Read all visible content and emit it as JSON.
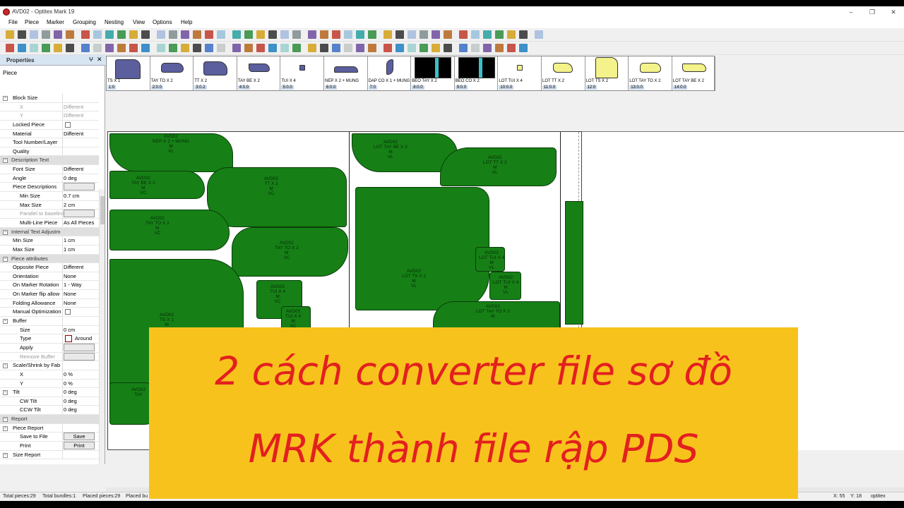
{
  "window": {
    "title": "AVD02 - Optitex Mark 19",
    "controls": [
      "–",
      "❐",
      "✕"
    ]
  },
  "menu": [
    "File",
    "Piece",
    "Marker",
    "Grouping",
    "Nesting",
    "View",
    "Options",
    "Help"
  ],
  "properties": {
    "header": "Properties",
    "pin": "ⵖ",
    "close": "✕",
    "subject": "Piece",
    "rows": [
      {
        "label": "Block Size",
        "value": "",
        "kind": "cat-plain"
      },
      {
        "label": "X",
        "value": "Different",
        "kind": "dim"
      },
      {
        "label": "Y",
        "value": "Different",
        "kind": "dim"
      },
      {
        "label": "Locked Piece",
        "value": "",
        "kind": "checkbox"
      },
      {
        "label": "Material",
        "value": "Different",
        "kind": "plain"
      },
      {
        "label": "Tool Number/Layer",
        "value": "",
        "kind": "plain"
      },
      {
        "label": "Quality",
        "value": "",
        "kind": "plain"
      },
      {
        "label": "Description Text",
        "value": "",
        "kind": "cat"
      },
      {
        "label": "Font Size",
        "value": "Different",
        "kind": "plain"
      },
      {
        "label": "Angle",
        "value": "0 deg",
        "kind": "plain"
      },
      {
        "label": "Piece Descriptions",
        "value": "",
        "kind": "button-empty"
      },
      {
        "label": "Min Size",
        "value": "0.7 cm",
        "kind": "sub"
      },
      {
        "label": "Max Size",
        "value": "2 cm",
        "kind": "sub"
      },
      {
        "label": "Parallel to baseline",
        "value": "",
        "kind": "sub-dim-btn"
      },
      {
        "label": "Multi-Line Piece",
        "value": "As All Pieces",
        "kind": "sub"
      },
      {
        "label": "Internal Text Adjustment",
        "value": "",
        "kind": "cat"
      },
      {
        "label": "Min Size",
        "value": "1 cm",
        "kind": "plain"
      },
      {
        "label": "Max Size",
        "value": "1 cm",
        "kind": "plain"
      },
      {
        "label": "Piece attributes",
        "value": "",
        "kind": "cat"
      },
      {
        "label": "Opposite Piece",
        "value": "Different",
        "kind": "plain"
      },
      {
        "label": "Orientation",
        "value": "None",
        "kind": "plain"
      },
      {
        "label": "On Marker Rotation",
        "value": "1 - Way",
        "kind": "plain"
      },
      {
        "label": "On Marker flip allow",
        "value": "None",
        "kind": "plain"
      },
      {
        "label": "Folding Allowance",
        "value": "None",
        "kind": "plain"
      },
      {
        "label": "Manual Optimization",
        "value": "",
        "kind": "checkbox"
      },
      {
        "label": "Buffer",
        "value": "",
        "kind": "cat-plain"
      },
      {
        "label": "Size",
        "value": "0 cm",
        "kind": "sub"
      },
      {
        "label": "Type",
        "value": "Around",
        "kind": "sub-swatch"
      },
      {
        "label": "Apply",
        "value": "",
        "kind": "sub-btn"
      },
      {
        "label": "Remove Buffer",
        "value": "",
        "kind": "sub-dim-btn"
      },
      {
        "label": "Scale/Shrink by Fab",
        "value": "",
        "kind": "cat-plain"
      },
      {
        "label": "X",
        "value": "0 %",
        "kind": "sub"
      },
      {
        "label": "Y",
        "value": "0 %",
        "kind": "sub"
      },
      {
        "label": "Tilt",
        "value": "0 deg",
        "kind": "cat-plain-val"
      },
      {
        "label": "CW Tilt",
        "value": "0 deg",
        "kind": "sub"
      },
      {
        "label": "CCW Tilt",
        "value": "0 deg",
        "kind": "sub"
      },
      {
        "label": "Report",
        "value": "",
        "kind": "cat"
      },
      {
        "label": "Piece Report",
        "value": "",
        "kind": "cat-plain"
      },
      {
        "label": "Save to File",
        "value": "Save",
        "kind": "sub-btn"
      },
      {
        "label": "Print",
        "value": "Print",
        "kind": "sub-btn"
      },
      {
        "label": "Size Report",
        "value": "",
        "kind": "cat-plain"
      }
    ]
  },
  "palette": [
    {
      "name": "TS X 1",
      "num": "1:0",
      "fill": "#5b5f9e",
      "dark": false
    },
    {
      "name": "TAY TO X 2",
      "num": "2:0.0",
      "fill": "#5b5f9e",
      "dark": false
    },
    {
      "name": "TT X 2",
      "num": "3:0.2",
      "fill": "#5b5f9e",
      "dark": false
    },
    {
      "name": "TAY BE X 2",
      "num": "4:0.0",
      "fill": "#5b5f9e",
      "dark": false
    },
    {
      "name": "TUI X 4",
      "num": "5:0.0",
      "fill": "#5b5f9e",
      "dark": false
    },
    {
      "name": "NEP X 2 + MUNG",
      "num": "6:0.0",
      "fill": "#5b5f9e",
      "dark": false
    },
    {
      "name": "DAP CO X 1 + MUNG",
      "num": "7:0",
      "fill": "#5b5f9e",
      "dark": false
    },
    {
      "name": "BEO TAY X 2",
      "num": "8:0.0",
      "fill": "#000000",
      "dark": true
    },
    {
      "name": "BEO CO X 2",
      "num": "9:0.0",
      "fill": "#000000",
      "dark": true
    },
    {
      "name": "LOT TUI X 4",
      "num": "10:0.0",
      "fill": "#f4f28a",
      "dark": false
    },
    {
      "name": "LOT TT X 2",
      "num": "11:0.0",
      "fill": "#f4f28a",
      "dark": false
    },
    {
      "name": "LOT TS X 2",
      "num": "12:0",
      "fill": "#f4f28a",
      "dark": false
    },
    {
      "name": "LOT TAY TO X 2",
      "num": "13:0.0",
      "fill": "#f4f28a",
      "dark": false
    },
    {
      "name": "LOT TAY BE X 2",
      "num": "14:0.0",
      "fill": "#f4f28a",
      "dark": false
    }
  ],
  "marker_pieces": [
    {
      "label": "AVD02\nNEP X 2 + MUNG\nM\nVL"
    },
    {
      "label": "AVD02\nTAY BE X 2\nM\nVC"
    },
    {
      "label": "AVD02\nTT X 2\nM\nVC"
    },
    {
      "label": "AVD02\nTAY TO X 2\nM\nVC"
    },
    {
      "label": "AVD02\nTAY TO X 2\nM\nVC"
    },
    {
      "label": "AVD02\nTS X 1\nM\nVC"
    },
    {
      "label": "AVD02\nTUI X 4\nM\nVC"
    },
    {
      "label": "AVD02\nTUI X 4\nM\nVC"
    },
    {
      "label": "AVD02\nLOT TAY BE X 2\nM\nVL"
    },
    {
      "label": "AVD02\nLOT TT X 2\nM\nVL"
    },
    {
      "label": "AVD02\nLOT TS X 2\nM\nVL"
    },
    {
      "label": "AVD02\nLOT TUI X 4\nM\nVL"
    },
    {
      "label": "AVD02\nLOT TUI X 4\nM\nVL"
    },
    {
      "label": "AVD02\nLOT TAY TO X 2\nM"
    },
    {
      "label": "AVD02\nTAY"
    }
  ],
  "status": {
    "total_pieces": "Total pieces:29",
    "total_bundles": "Total bundles:1",
    "placed_pieces": "Placed pieces:29",
    "placed_b": "Placed bu",
    "x": "X: 55",
    "y": "Y: 18",
    "brand": "optitex"
  },
  "banner": {
    "line1": "2 cách converter file sơ đồ",
    "line2": "MRK thành file rập PDS",
    "background": "#f8c21d",
    "text_color": "#e3201f"
  }
}
